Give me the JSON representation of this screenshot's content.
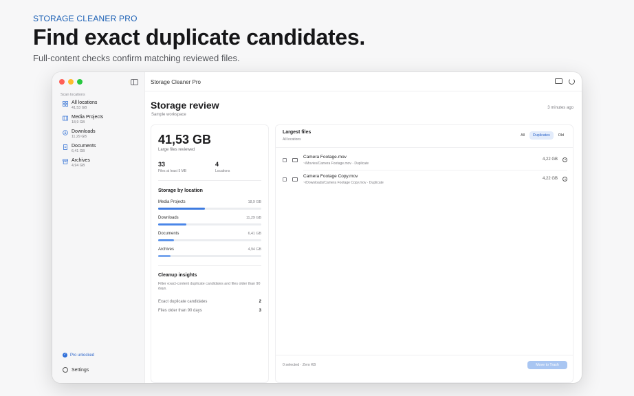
{
  "hero": {
    "eyebrow": "STORAGE CLEANER PRO",
    "title": "Find exact duplicate candidates.",
    "subtitle": "Full-content checks confirm matching reviewed files."
  },
  "sidebar": {
    "section_label": "Scan locations",
    "items": [
      {
        "label": "All locations",
        "size": "41,53 GB",
        "icon": "grid-icon"
      },
      {
        "label": "Media Projects",
        "size": "18,9 GB",
        "icon": "film-icon"
      },
      {
        "label": "Downloads",
        "size": "11,29 GB",
        "icon": "download-icon"
      },
      {
        "label": "Documents",
        "size": "6,41 GB",
        "icon": "document-icon"
      },
      {
        "label": "Archives",
        "size": "4,94 GB",
        "icon": "archive-icon"
      }
    ],
    "pro_label": "Pro unlocked",
    "settings_label": "Settings"
  },
  "titlebar": {
    "title": "Storage Cleaner Pro"
  },
  "header": {
    "title": "Storage review",
    "subtitle": "Sample workspace",
    "updated": "3 minutes ago"
  },
  "summary": {
    "total_size": "41,53 GB",
    "total_label": "Large files reviewed",
    "files_count": "33",
    "files_label": "Files at least 5 MB",
    "locations_count": "4",
    "locations_label": "Locations"
  },
  "storage_by_location": {
    "title": "Storage by location",
    "items": [
      {
        "name": "Media Projects",
        "size": "18,9 GB",
        "fraction": 0.455,
        "color": "#3e7be0"
      },
      {
        "name": "Downloads",
        "size": "11,29 GB",
        "fraction": 0.272,
        "color": "#4a86e8"
      },
      {
        "name": "Documents",
        "size": "6,41 GB",
        "fraction": 0.154,
        "color": "#5b93ea"
      },
      {
        "name": "Archives",
        "size": "4,94 GB",
        "fraction": 0.119,
        "color": "#7aa7ee"
      }
    ]
  },
  "insights": {
    "title": "Cleanup insights",
    "description": "Filter exact-content duplicate candidates and files older than 90 days.",
    "rows": [
      {
        "label": "Exact duplicate candidates",
        "value": "2"
      },
      {
        "label": "Files older than 90 days",
        "value": "3"
      }
    ]
  },
  "largest_files": {
    "title": "Largest files",
    "subtitle": "All locations",
    "filters": [
      "All",
      "Duplicates",
      "Old"
    ],
    "active_filter": "Duplicates",
    "files": [
      {
        "name": "Camera Footage.mov",
        "path": "~/Movies/Camera Footage.mov  ·  Duplicate",
        "size": "4,22 GB"
      },
      {
        "name": "Camera Footage Copy.mov",
        "path": "~/Downloads/Camera Footage Copy.mov  ·  Duplicate",
        "size": "4,22 GB"
      }
    ],
    "selection": "0 selected · Zero KB",
    "move_button": "Move to Trash"
  }
}
